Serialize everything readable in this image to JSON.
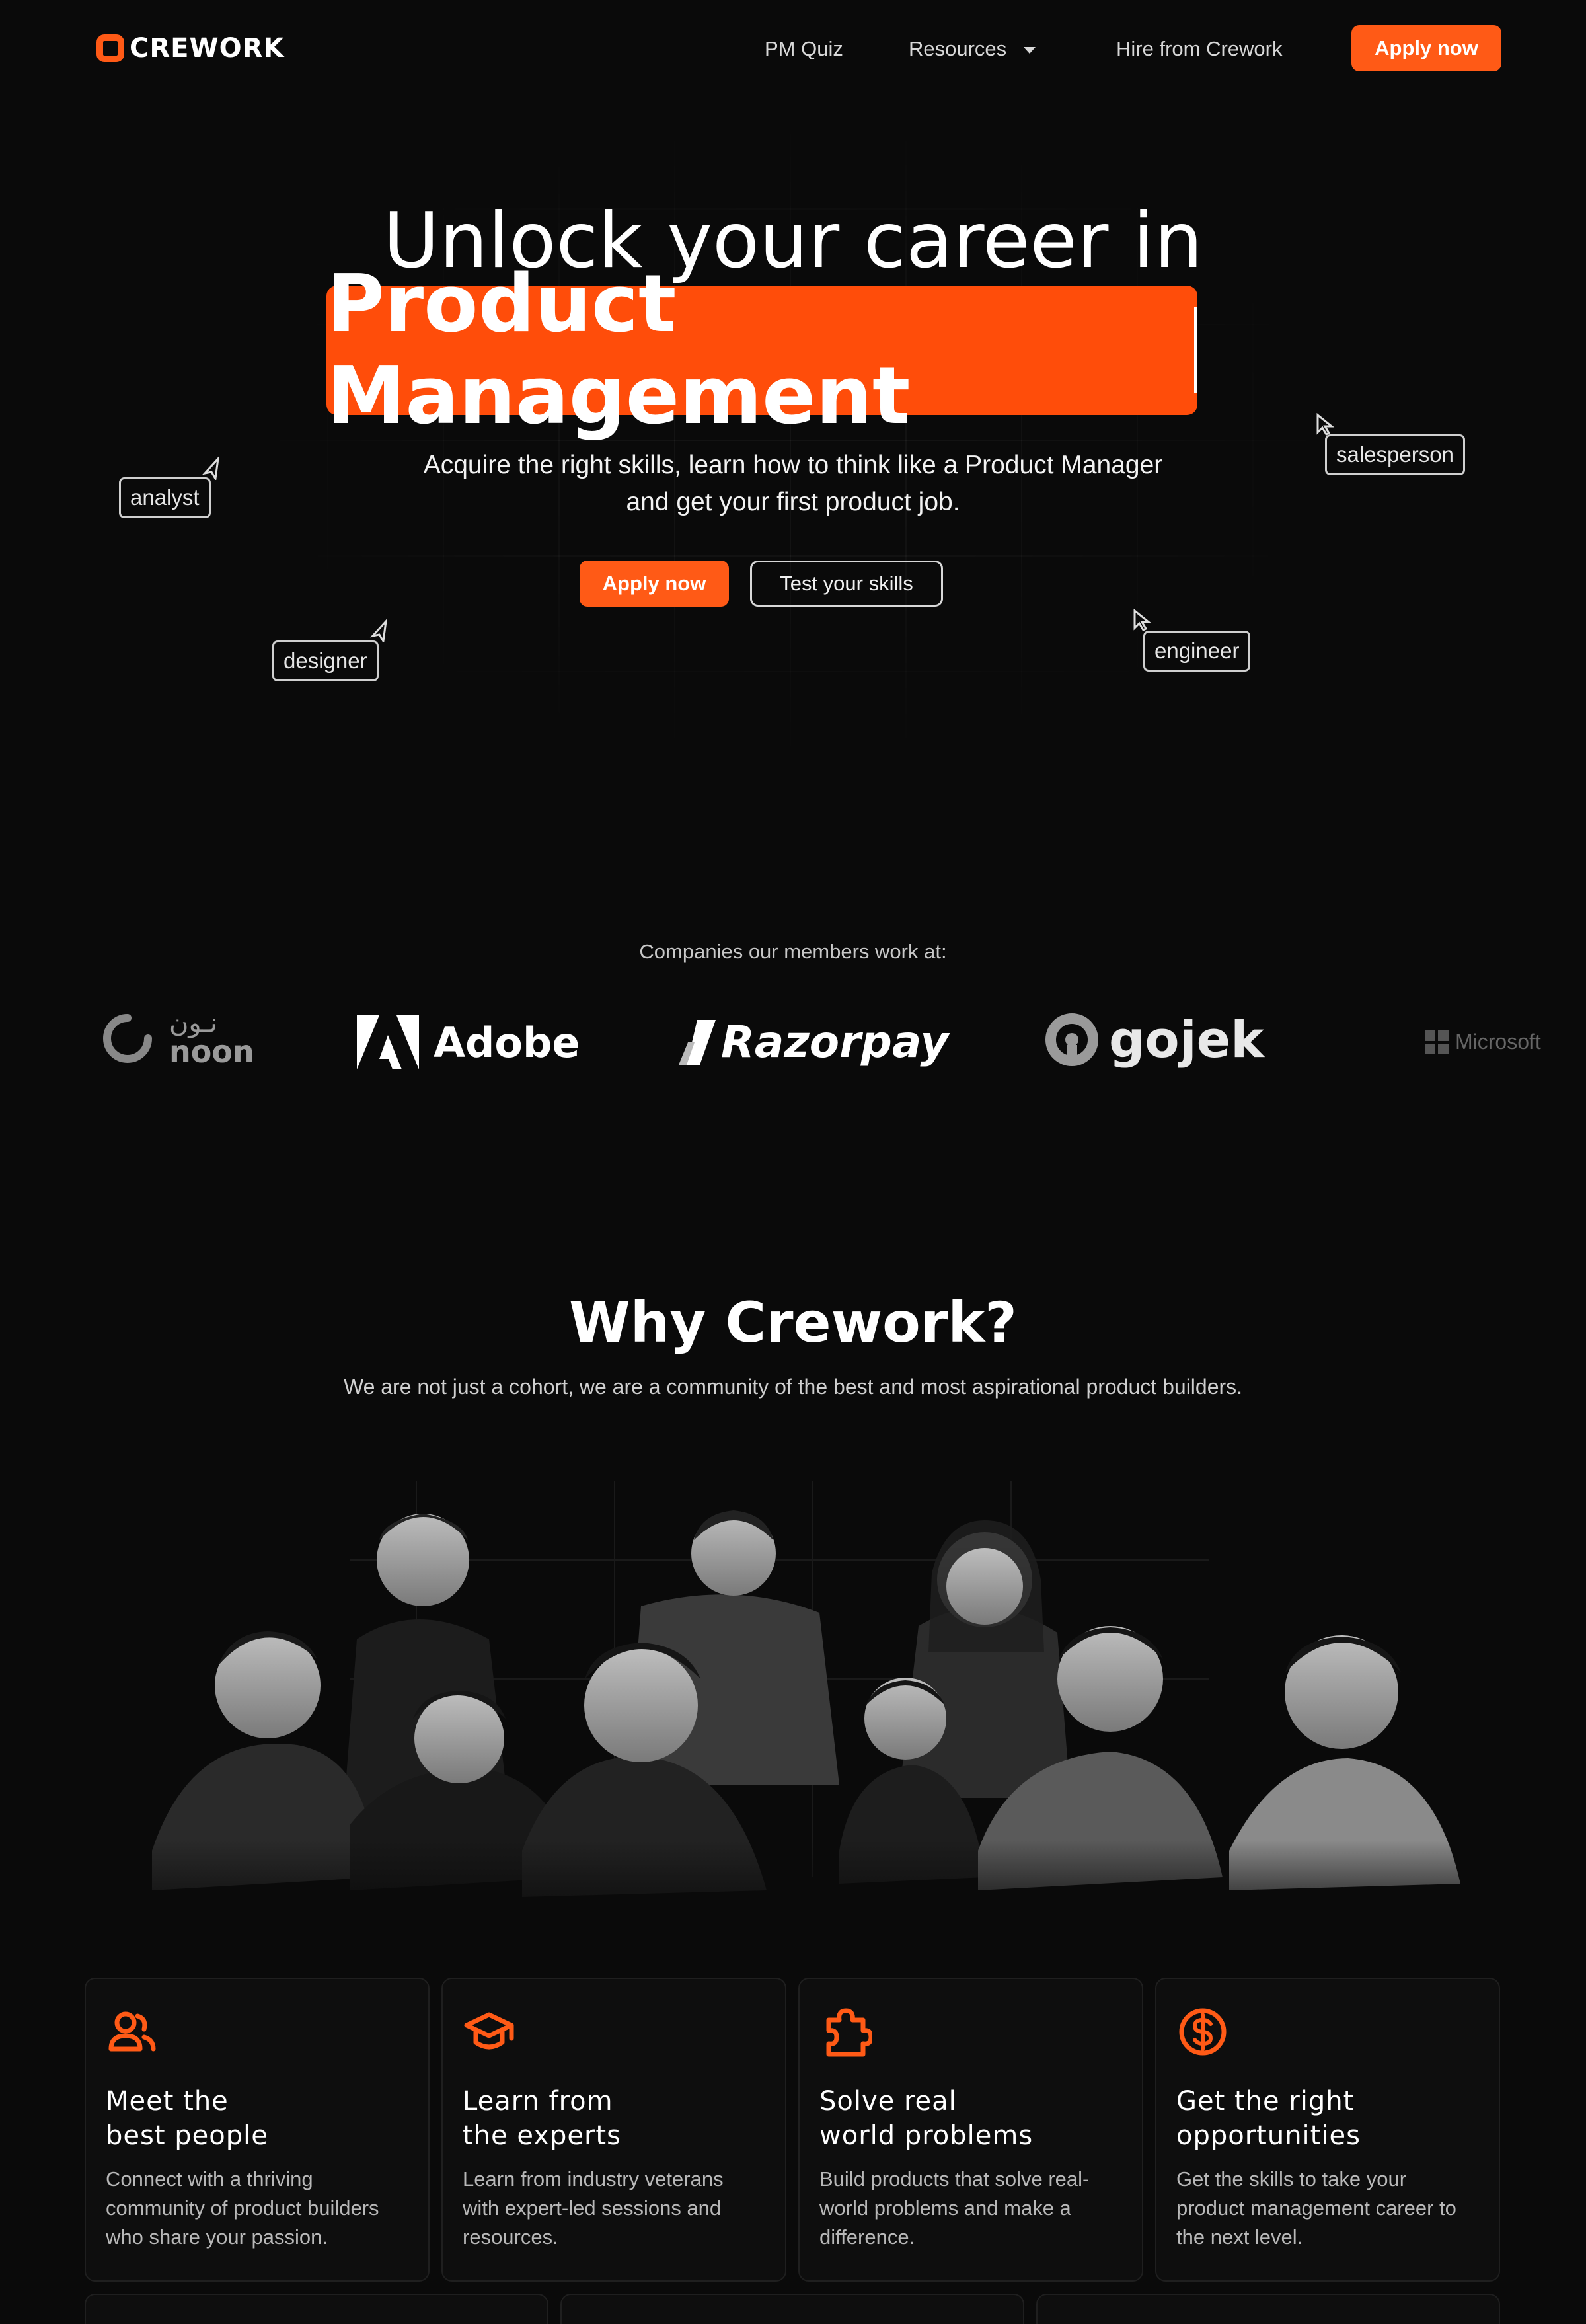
{
  "nav": {
    "logo_text": "CREWORK",
    "links": [
      "PM Quiz",
      "Resources",
      "Hire from Crework"
    ],
    "cta": "Apply now"
  },
  "hero": {
    "line1": "Unlock your career in",
    "highlight": "Product Management",
    "subtitle_line1": "Acquire the right skills, learn how to think like a Product Manager",
    "subtitle_line2": "and get your first product job.",
    "primary_cta": "Apply now",
    "secondary_cta": "Test your skills",
    "tags": [
      "analyst",
      "salesperson",
      "designer",
      "engineer"
    ]
  },
  "companies": {
    "title": "Companies our members work at:",
    "logos": [
      "noon",
      "Adobe",
      "Razorpay",
      "gojek",
      "Microsoft"
    ],
    "noon_arabic": "نـون"
  },
  "why": {
    "title": "Why Crework?",
    "subtitle": "We are not just a cohort, we are a community of the best and most aspirational product builders."
  },
  "features": [
    {
      "icon": "users-icon",
      "title": "Meet the\nbest people",
      "desc": "Connect with a thriving community of product builders who share your passion."
    },
    {
      "icon": "graduation-cap-icon",
      "title": "Learn from\nthe experts",
      "desc": "Learn from industry veterans with expert-led sessions and resources."
    },
    {
      "icon": "puzzle-icon",
      "title": "Solve real\nworld problems",
      "desc": "Build products that solve real-world problems and make a difference."
    },
    {
      "icon": "dollar-coin-icon",
      "title": "Get the right\nopportunities",
      "desc": "Get the skills to take your product management career to the next level."
    }
  ],
  "colors": {
    "accent": "#ff5a16",
    "background": "#0a0a0a"
  }
}
